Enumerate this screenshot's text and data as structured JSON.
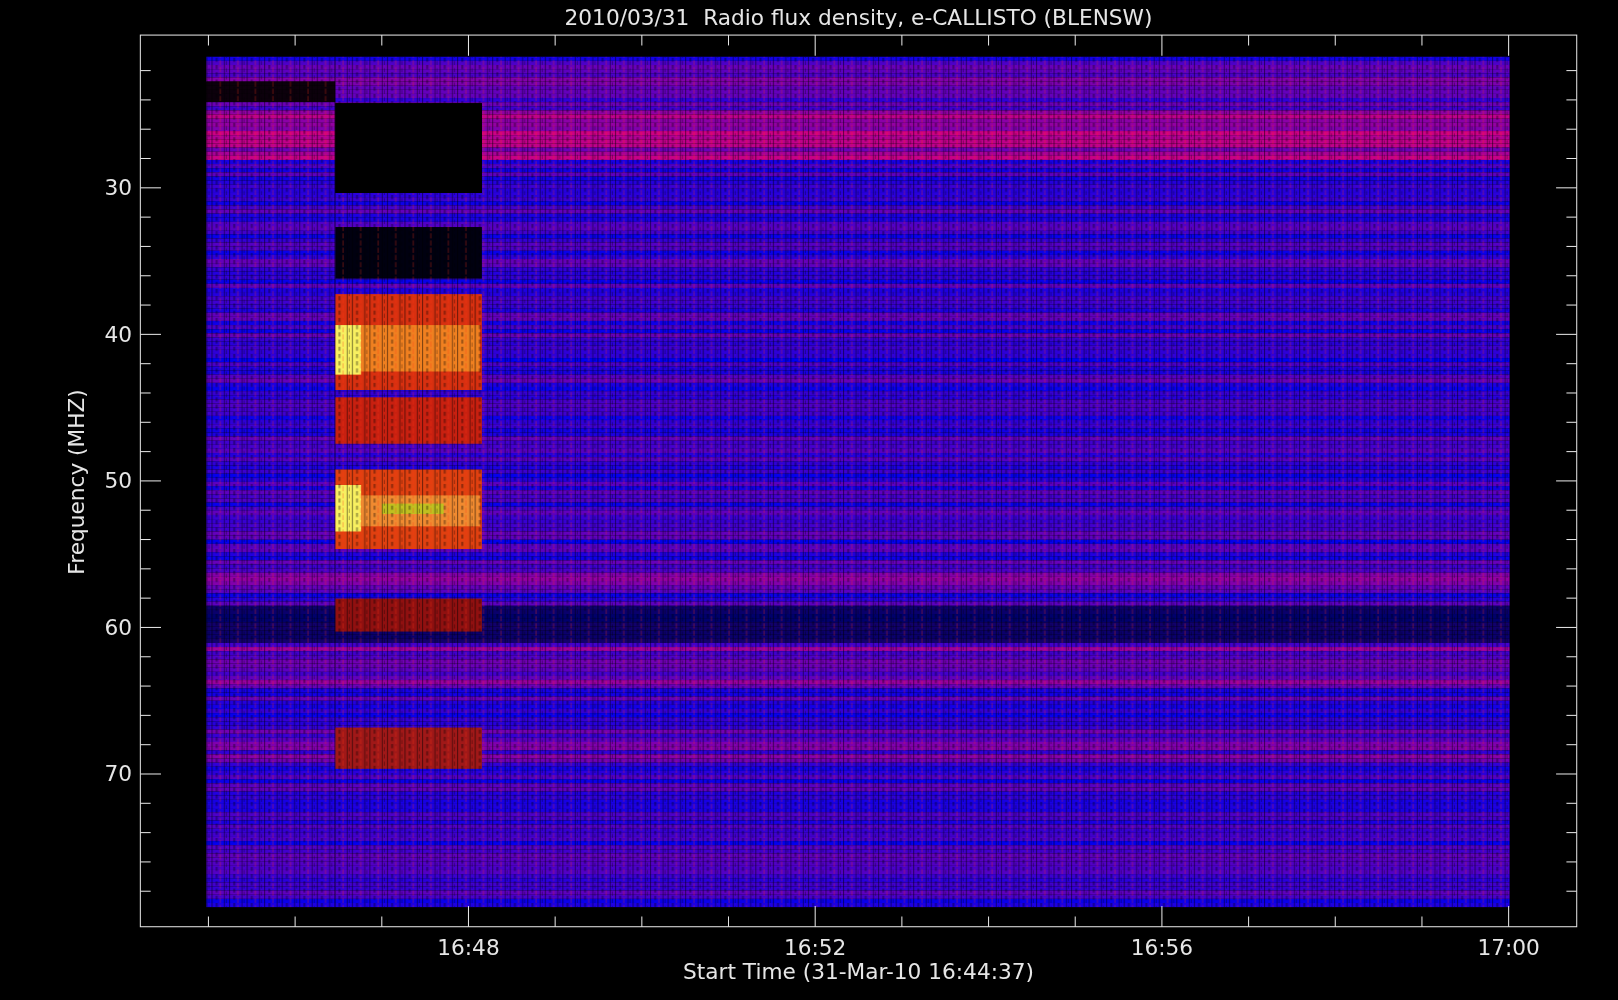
{
  "plot": {
    "title": "2010/03/31  Radio flux density, e-CALLISTO (BLENSW)",
    "xlabel": "Start Time (31-Mar-10 16:44:37)",
    "ylabel": "Frequency (MHZ)",
    "xticks": [
      "16:48",
      "16:52",
      "16:56",
      "17:00"
    ],
    "yticks": [
      "30",
      "40",
      "50",
      "60",
      "70"
    ]
  }
}
